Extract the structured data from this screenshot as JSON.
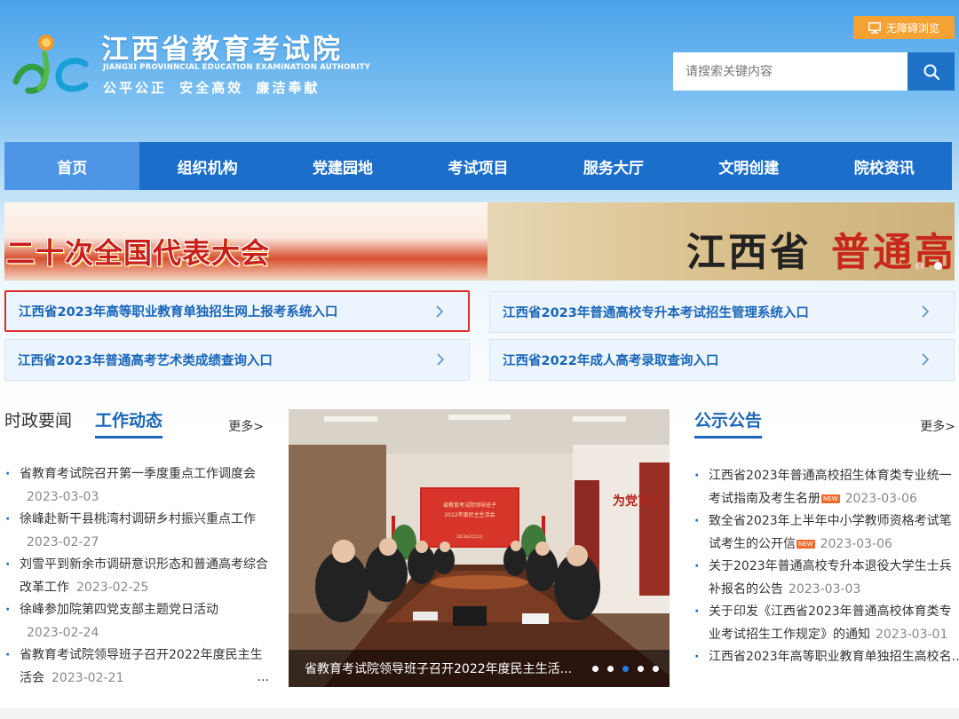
{
  "header": {
    "title": "江西省教育考试院",
    "subtitle_en": "JIANGXI PROVINNCIAL EDUCATION EXAMINATION AUTHORITY",
    "slogan": "公平公正  安全高效  廉洁奉献",
    "accessibility_label": "无障碍浏览",
    "search_placeholder": "请搜索关键内容"
  },
  "nav": {
    "items": [
      "首页",
      "组织机构",
      "党建园地",
      "考试项目",
      "服务大厅",
      "文明创建",
      "院校资讯"
    ],
    "active_index": 0
  },
  "banner": {
    "left_text": "二十次全国代表大会",
    "right_text_dark": "江西省",
    "right_text_red": "普通高"
  },
  "quick_links": [
    "江西省2023年高等职业教育单独招生网上报考系统入口",
    "江西省2023年普通高校专升本考试招生管理系统入口",
    "江西省2023年普通高考艺术类成绩查询入口",
    "江西省2022年成人高考录取查询入口"
  ],
  "news": {
    "tabs": [
      "时政要闻",
      "工作动态"
    ],
    "active_tab": 1,
    "more_label": "更多>",
    "items": [
      {
        "title": "省教育考试院召开第一季度重点工作调度会",
        "date": "2023-03-03"
      },
      {
        "title": "徐峰赴新干县桃湾村调研乡村振兴重点工作",
        "date": "2023-02-27"
      },
      {
        "title": "刘雪平到新余市调研意识形态和普通高考综合改革工作",
        "date": "2023-02-25"
      },
      {
        "title": "徐峰参加院第四党支部主题党日活动",
        "date": "2023-02-24"
      },
      {
        "title": "省教育考试院领导班子召开2022年度民主生活会",
        "date": "2023-02-21"
      }
    ],
    "ellipsis": "..."
  },
  "photo": {
    "caption": "省教育考试院领导班子召开2022年度民主生活",
    "screen_line1": "省教育考试院领导班子",
    "screen_line2": "2022年度民主生活会",
    "screen_date": "2023年2月21日",
    "wall_text": "为党育人"
  },
  "notices": {
    "title": "公示公告",
    "more_label": "更多>",
    "new_label": "NEW",
    "items": [
      {
        "title": "江西省2023年普通高校招生体育类专业统一考试指南及考生名册",
        "date": "2023-03-06",
        "is_new": true
      },
      {
        "title": "致全省2023年上半年中小学教师资格考试笔试考生的公开信",
        "date": "2023-03-06",
        "is_new": true
      },
      {
        "title": "关于2023年普通高校专升本退役大学生士兵补报名的公告",
        "date": "2023-03-03",
        "is_new": false
      },
      {
        "title": "关于印发《江西省2023年普通高校体育类专业考试招生工作规定》的通知",
        "date": "2023-03-01",
        "is_new": false
      },
      {
        "title": "江西省2023年高等职业教育单独招生高校名...",
        "date": "",
        "is_new": false
      }
    ]
  },
  "colors": {
    "nav_bg": "#1b6fcb",
    "nav_active": "#4e95e6",
    "link_blue": "#1a66b8",
    "access_orange": "#f4a233",
    "highlight_red": "#e02a2a"
  },
  "icons": {
    "access": "monitor-icon",
    "search": "search-icon",
    "quick_link_arrow": "chevron-right-icon"
  }
}
